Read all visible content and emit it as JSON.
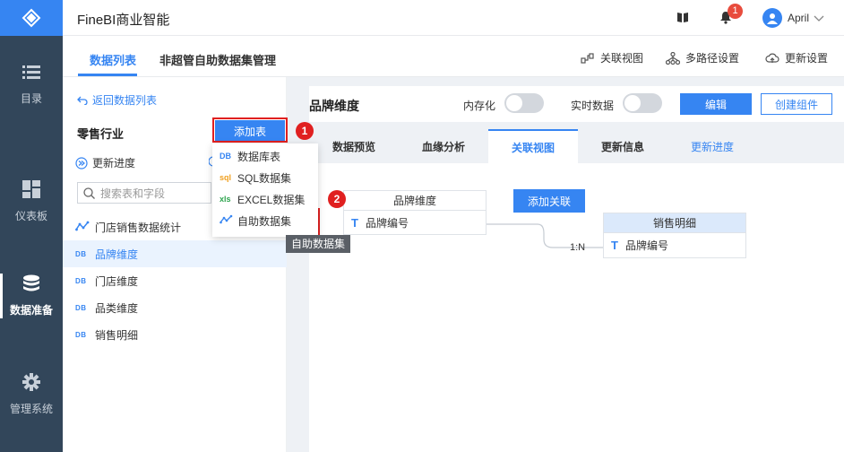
{
  "app": {
    "title": "FineBI商业智能",
    "notification_count": "1",
    "user_name": "April"
  },
  "nav": [
    {
      "label": "目录",
      "icon": "list-icon"
    },
    {
      "label": "仪表板",
      "icon": "dashboard-icon"
    },
    {
      "label": "数据准备",
      "icon": "database-icon",
      "active": true
    },
    {
      "label": "管理系统",
      "icon": "gear-icon"
    }
  ],
  "tabs": {
    "data_list": "数据列表",
    "self_service_mgmt": "非超管自助数据集管理"
  },
  "toolbar": {
    "relation_view": "关联视图",
    "multipath": "多路径设置",
    "update_settings": "更新设置"
  },
  "left": {
    "back": "返回数据列表",
    "package_title": "零售行业",
    "add_table": "添加表",
    "update_progress": "更新进度",
    "search_placeholder": "搜索表和字段",
    "items": [
      {
        "label": "门店销售数据统计",
        "type": "selfhelp"
      },
      {
        "label": "品牌维度",
        "type": "DB",
        "selected": true
      },
      {
        "label": "门店维度",
        "type": "DB"
      },
      {
        "label": "品类维度",
        "type": "DB"
      },
      {
        "label": "销售明细",
        "type": "DB"
      }
    ]
  },
  "dropdown": {
    "items": [
      {
        "tag": "DB",
        "label": "数据库表"
      },
      {
        "tag": "sql",
        "label": "SQL数据集"
      },
      {
        "tag": "xls",
        "label": "EXCEL数据集"
      },
      {
        "tag": "self",
        "label": "自助数据集"
      }
    ],
    "tooltip": "自助数据集"
  },
  "steps": [
    "1",
    "2"
  ],
  "main": {
    "title": "品牌维度",
    "in_memory": "内存化",
    "realtime": "实时数据",
    "edit": "编辑",
    "create_component": "创建组件",
    "subtabs": [
      "数据预览",
      "血缘分析",
      "关联视图",
      "更新信息",
      "更新进度"
    ],
    "entity_left": {
      "name": "品牌维度",
      "field": "品牌编号"
    },
    "entity_right": {
      "name": "销售明细",
      "field": "品牌编号"
    },
    "add_relation": "添加关联",
    "relation": "1:N"
  },
  "colors": {
    "accent": "#3685f2",
    "nav_bg": "#32465a",
    "highlight": "#e02020"
  }
}
